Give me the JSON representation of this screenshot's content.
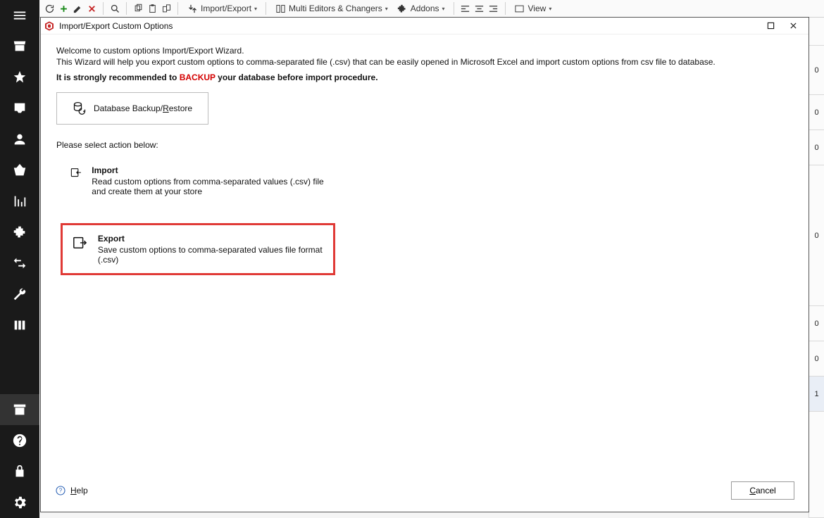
{
  "toolbar": {
    "import_export": "Import/Export",
    "multi_editors": "Multi Editors & Changers",
    "addons": "Addons",
    "view": "View"
  },
  "right_col_values": [
    "0",
    "0",
    "0",
    "0",
    "0",
    "0",
    "1"
  ],
  "dialog": {
    "title": "Import/Export Custom Options",
    "intro1": "Welcome to custom options Import/Export Wizard.",
    "intro2": "This Wizard will help you export custom options to comma-separated file (.csv) that can be easily opened in Microsoft Excel and import custom options from csv file to database.",
    "backup_pre": "It is strongly recommended to ",
    "backup_kw": "BACKUP",
    "backup_post": " your database before import procedure.",
    "backup_btn_pre": "Database Backup/",
    "backup_btn_hot": "R",
    "backup_btn_post": "estore",
    "select_line": "Please select action below:",
    "import_title": "Import",
    "import_desc": "Read custom options from comma-separated values (.csv) file and create them at your store",
    "export_title": "Export",
    "export_desc": "Save custom options to comma-separated values file format (.csv)",
    "help_hot": "H",
    "help_post": "elp",
    "cancel_hot": "C",
    "cancel_post": "ancel"
  }
}
